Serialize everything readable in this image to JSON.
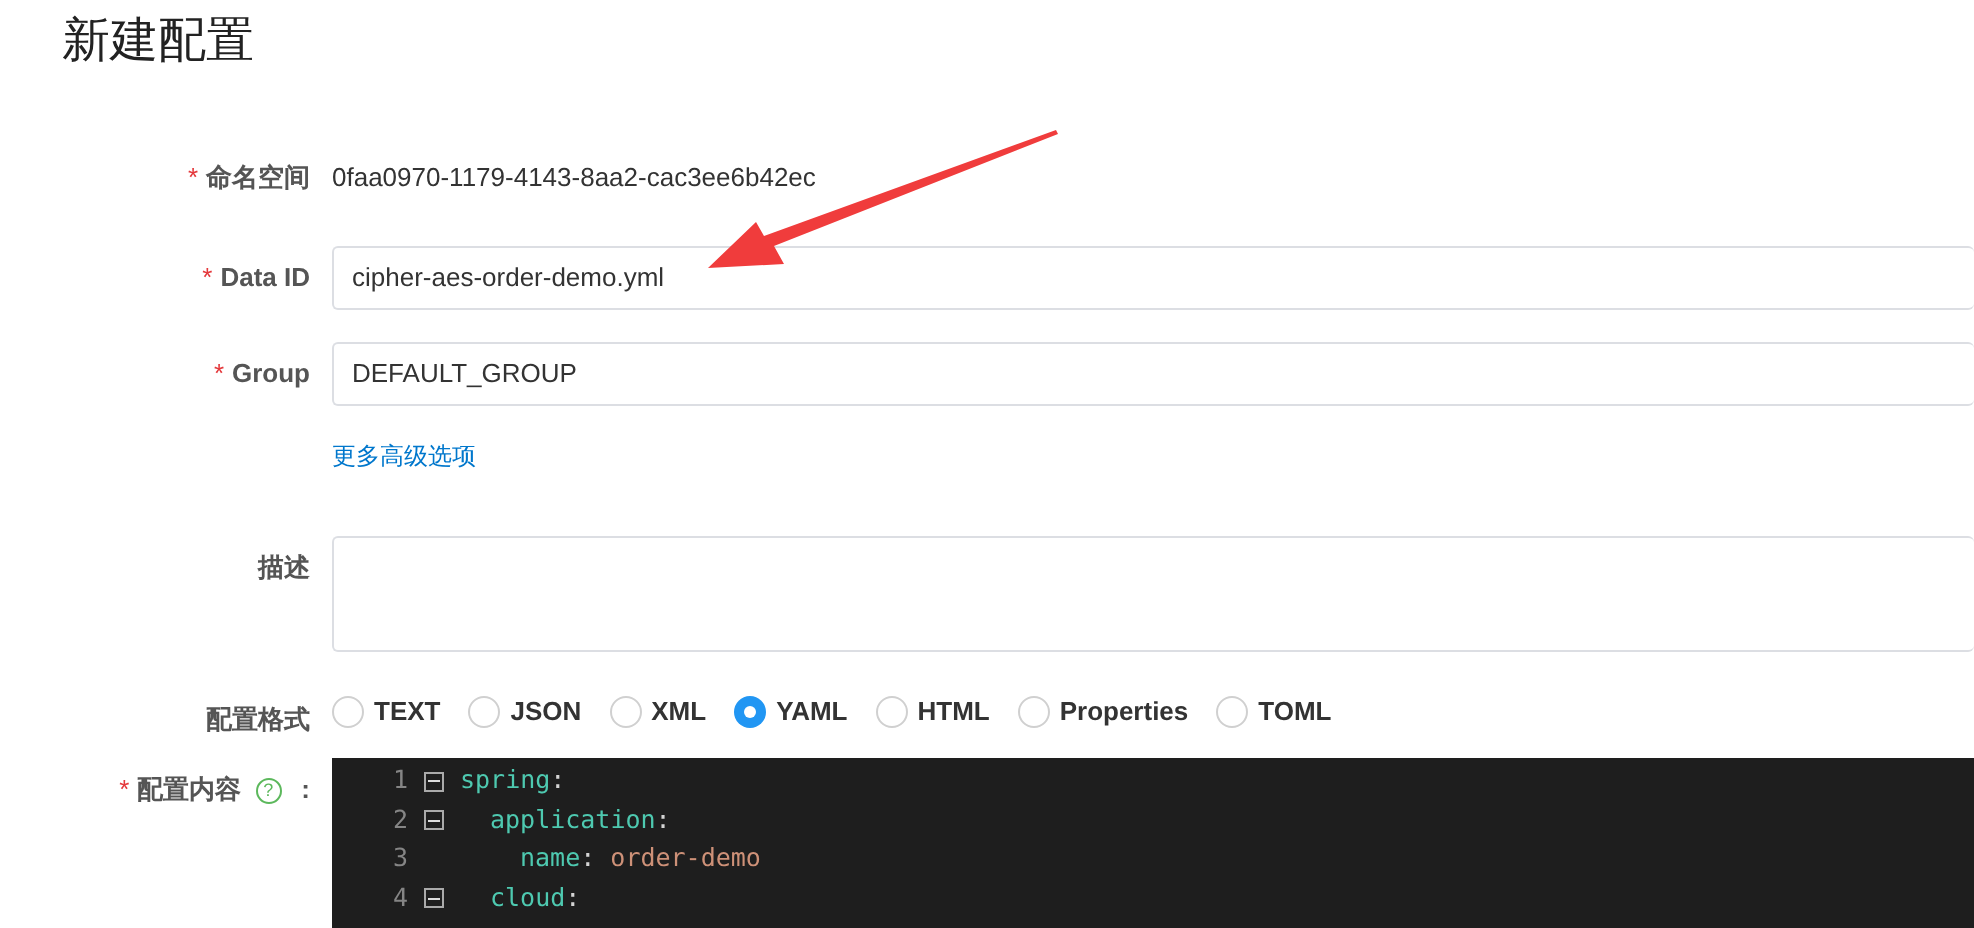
{
  "page_title": "新建配置",
  "namespace": {
    "label": "命名空间",
    "required_mark": "*",
    "value": "0faa0970-1179-4143-8aa2-cac3ee6b42ec"
  },
  "data_id": {
    "label": "Data ID",
    "required_mark": "*",
    "value": "cipher-aes-order-demo.yml"
  },
  "group": {
    "label": "Group",
    "required_mark": "*",
    "value": "DEFAULT_GROUP"
  },
  "advanced_link": "更多高级选项",
  "description": {
    "label": "描述"
  },
  "format": {
    "label": "配置格式",
    "options": [
      {
        "label": "TEXT",
        "selected": false
      },
      {
        "label": "JSON",
        "selected": false
      },
      {
        "label": "XML",
        "selected": false
      },
      {
        "label": "YAML",
        "selected": true
      },
      {
        "label": "HTML",
        "selected": false
      },
      {
        "label": "Properties",
        "selected": false
      },
      {
        "label": "TOML",
        "selected": false
      }
    ]
  },
  "content": {
    "label": "配置内容",
    "required_mark": "*",
    "help": "?",
    "colon": ":",
    "lines": [
      {
        "number": "1",
        "foldable": true,
        "key": "spring",
        "sep": ":",
        "children": [
          {
            "number": "2",
            "foldable": true,
            "key": "application",
            "sep": ":",
            "children": [
              {
                "number": "3",
                "foldable": false,
                "key": "name",
                "sep": ":",
                "value": "order-demo"
              }
            ]
          },
          {
            "number": "4",
            "foldable": true,
            "key": "cloud",
            "sep": ":"
          }
        ]
      }
    ]
  },
  "annotation": {
    "kind": "arrow"
  }
}
